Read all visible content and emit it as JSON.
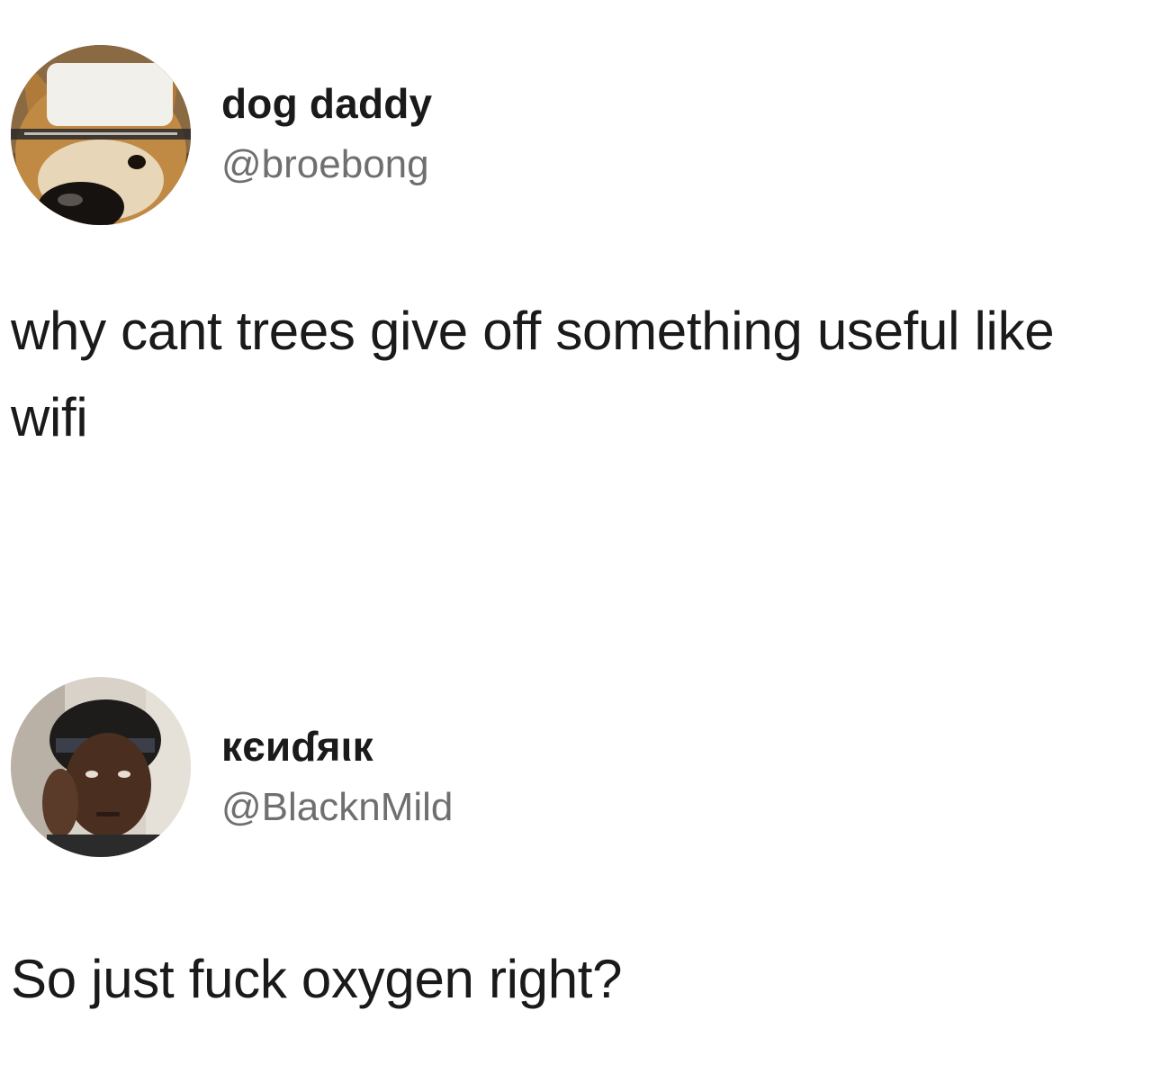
{
  "tweets": [
    {
      "display_name": "dog daddy",
      "handle": "@broebong",
      "text": "why cant trees give off something useful like wifi",
      "avatar_icon": "dog-photo-avatar"
    },
    {
      "display_name": "кєиɗяιк",
      "handle": "@BlacknMild",
      "text": "So just fuck oxygen right?",
      "avatar_icon": "person-photo-avatar"
    }
  ]
}
